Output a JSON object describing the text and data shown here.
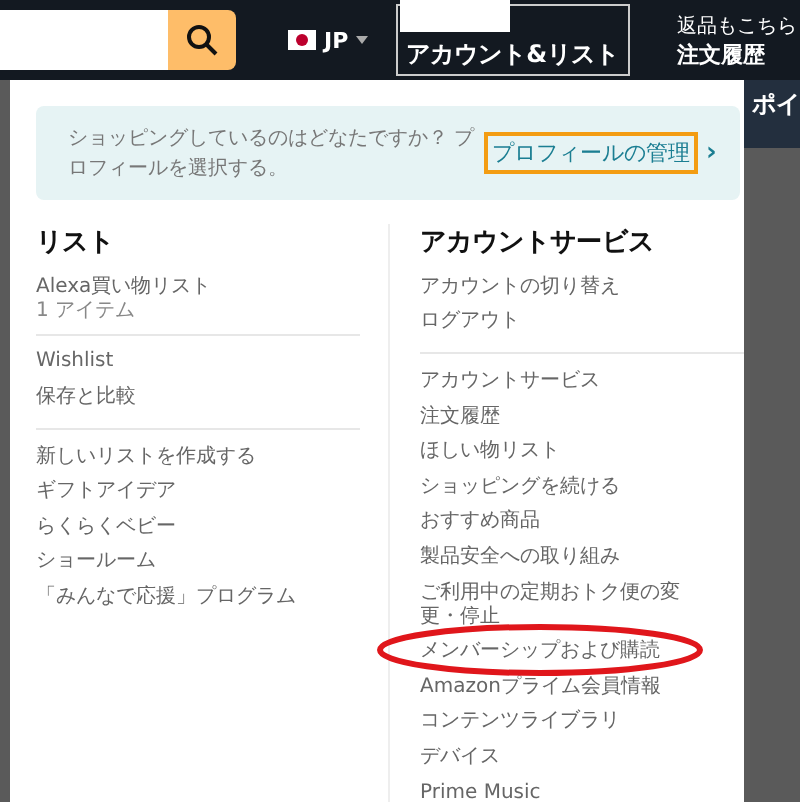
{
  "header": {
    "country": "JP",
    "account_label": "アカウント&リスト",
    "returns_label": "返品もこちら",
    "orders_label": "注文履歴",
    "side_text": "ポイ"
  },
  "profile_banner": {
    "text": "ショッピングしているのはどなたですか？ プロフィールを選択する。",
    "link": "プロフィールの管理",
    "chevron": "›"
  },
  "lists": {
    "title": "リスト",
    "groups": [
      [
        {
          "label": "Alexa買い物リスト",
          "sub": "1 アイテム"
        }
      ],
      [
        {
          "label": "Wishlist"
        },
        {
          "label": "保存と比較"
        }
      ],
      [
        {
          "label": "新しいリストを作成する"
        },
        {
          "label": "ギフトアイデア"
        },
        {
          "label": "らくらくベビー"
        },
        {
          "label": "ショールーム"
        },
        {
          "label": "「みんなで応援」プログラム"
        }
      ]
    ]
  },
  "account_services": {
    "title": "アカウントサービス",
    "groups": [
      [
        {
          "label": "アカウントの切り替え"
        },
        {
          "label": "ログアウト"
        }
      ],
      [
        {
          "label": "アカウントサービス"
        },
        {
          "label": "注文履歴"
        },
        {
          "label": "ほしい物リスト"
        },
        {
          "label": "ショッピングを続ける"
        },
        {
          "label": "おすすめ商品"
        },
        {
          "label": "製品安全への取り組み"
        },
        {
          "label": "ご利用中の定期おトク便の変更・停止"
        },
        {
          "label": "メンバーシップおよび購読"
        },
        {
          "label": "Amazonプライム会員情報"
        },
        {
          "label": "コンテンツライブラリ"
        },
        {
          "label": "デバイス"
        },
        {
          "label": "Prime Music"
        }
      ]
    ]
  }
}
